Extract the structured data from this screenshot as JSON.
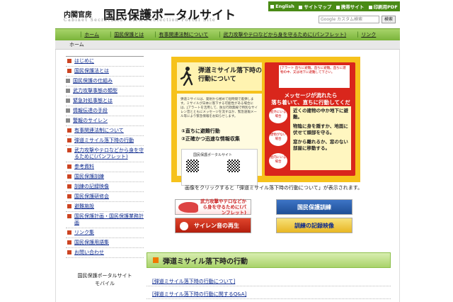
{
  "header": {
    "ministry": "内閣官房",
    "title": "国民保護ポータルサイト",
    "subtitle": "Cabinet Secretariat Civil Protection Portal Site",
    "util": [
      "English",
      "サイトマップ",
      "携帯サイト",
      "印刷用PDF"
    ],
    "search_placeholder": "Google カスタム検索",
    "search_button": "検索"
  },
  "nav": [
    "ホーム",
    "国民保護とは",
    "有事関連法制について",
    "武力攻撃やテロなどから身を守るために(パンフレット)",
    "リンク"
  ],
  "breadcrumb": "ホーム",
  "sidebar": {
    "items": [
      {
        "label": "はじめに",
        "sub": false
      },
      {
        "label": "国民保護法とは",
        "sub": false
      },
      {
        "label": "国民保護の仕組み",
        "sub": true
      },
      {
        "label": "武力攻撃事態の類型",
        "sub": true
      },
      {
        "label": "緊急対処事態とは",
        "sub": true
      },
      {
        "label": "情報伝達の手段",
        "sub": true
      },
      {
        "label": "警報のサイレン",
        "sub": true
      },
      {
        "label": "有事関連法制について",
        "sub": false
      },
      {
        "label": "弾道ミサイル落下時の行動",
        "sub": false
      },
      {
        "label": "武力攻撃やテロなどから身を守るために(パンフレット)",
        "sub": false
      },
      {
        "label": "参考資料",
        "sub": false
      },
      {
        "label": "国民保護訓練",
        "sub": false
      },
      {
        "label": "訓練の記録映像",
        "sub": false
      },
      {
        "label": "国民保護研修会",
        "sub": false
      },
      {
        "label": "避難施設",
        "sub": false
      },
      {
        "label": "国民保護計画・国民保護業務計画",
        "sub": false
      },
      {
        "label": "リンク集",
        "sub": false
      },
      {
        "label": "国民保護用語集",
        "sub": false
      },
      {
        "label": "お問い合わせ",
        "sub": false
      }
    ],
    "mobile_line1": "国民保護ポータルサイト",
    "mobile_line2": "モバイル"
  },
  "banner": {
    "title1": "弾道ミサイル落下時の",
    "title2": "行動について",
    "body_text": "弾道ミサイルは、発射から極めて短時間で着弾します。ミサイルが日本に落下する可能性がある場合には、Jアラートを活用して、防災行政無線で特別なサイレン音とともにメッセージを流すほか、緊急速報メール等により緊急情報をお知らせします。",
    "step1": "①直ちに避難行動",
    "step2": "②正確かつ迅速な情報収集",
    "card_title": "国民保護ポータルサイト",
    "red_header": "Jアラート 直ちに避難。直ちに避難。直ちに建物の中、又は地下に避難して下さい。",
    "red_big1": "メッセージが流れたら",
    "red_big2": "落ち着いて、直ちに行動してください。",
    "yel_lines": [
      "近くの建物の中か地下に避難。",
      "物陰に身を隠すか、地面に伏せて頭部を守る。",
      "窓から離れるか、窓のない部屋に移動する。"
    ],
    "side_labels": [
      "屋外にいる場合",
      "建物がない場合",
      "屋内にいる場合"
    ]
  },
  "caption": "画像をクリックすると「弾道ミサイル落下時の行動について」が表示されます。",
  "buttons": {
    "pamphlet": "武力攻撃やテロなどから身を守るために(パンフレット)",
    "training": "国民保護訓練",
    "siren": "サイレン音の再生",
    "record": "訓練の記録映像"
  },
  "section": {
    "title": "弾道ミサイル落下時の行動",
    "link1": "[弾道ミサイル落下時の行動について]",
    "link2": "[弾道ミサイル落下時の行動に関するQ&A]"
  },
  "colors": {
    "header_green": "#4a8b16",
    "nav_green": "#7ab43a",
    "banner_yellow": "#f6c21c",
    "alert_red": "#d9261c",
    "link_blue": "#0d2a8e"
  }
}
